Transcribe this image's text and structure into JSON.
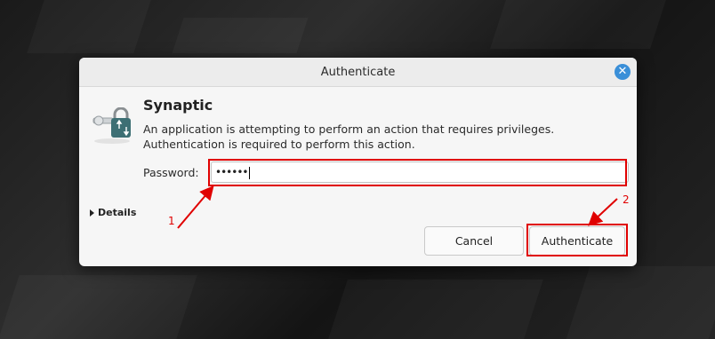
{
  "dialog": {
    "title": "Authenticate",
    "app_name": "Synaptic",
    "message": "An application is attempting to perform an action that requires privileges. Authentication is required to perform this action.",
    "password_label": "Password:",
    "password_value": "••••••",
    "details_label": "Details",
    "cancel_label": "Cancel",
    "authenticate_label": "Authenticate",
    "close_glyph": "✕"
  },
  "annotations": {
    "step1": "1",
    "step2": "2",
    "color": "#e00000"
  },
  "colors": {
    "close_button": "#3a8fd8",
    "dialog_bg": "#f6f6f6"
  },
  "icons": {
    "app": "lock-key-icon",
    "close": "close-icon",
    "expander": "triangle-right-icon"
  }
}
